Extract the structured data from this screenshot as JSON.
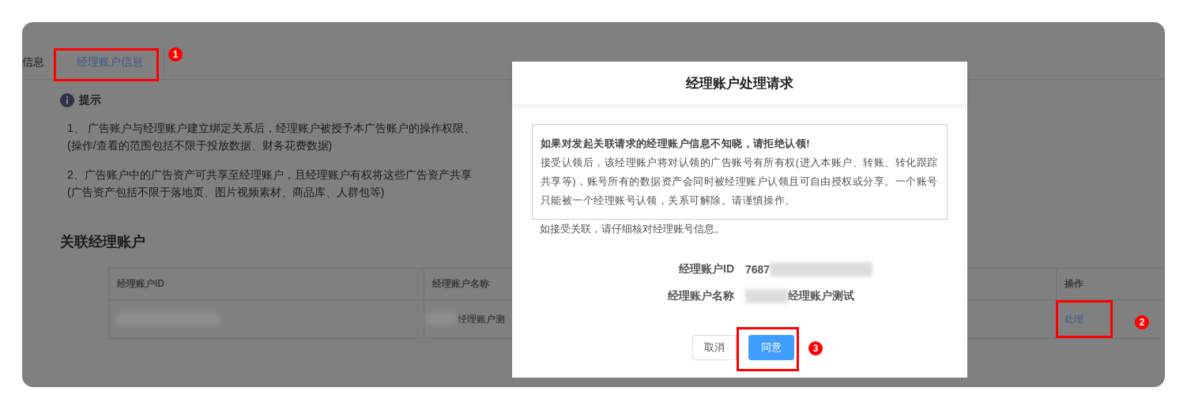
{
  "tabs": [
    {
      "label": "信息",
      "selected": false
    },
    {
      "label": "经理账户信息",
      "selected": true
    }
  ],
  "tip": {
    "title": "提示",
    "paragraphs": [
      [
        "1、 广告账户与经理账户建立绑定关系后，经理账户被授予本广告账户的操作权限、",
        "(操作/查看的范围包括不限于投放数据、财务花费数据)"
      ],
      [
        "2、广告账户中的广告资产可共享至经理账户，且经理账户有权将这些广告资产共享",
        "(广告资产包括不限于落地页、图片视频素材、商品库、人群包等)"
      ]
    ]
  },
  "section_title": "关联经理账户",
  "table": {
    "columns": [
      "经理账户ID",
      "经理账户名称",
      "操作"
    ],
    "rows": [
      {
        "cells": [
          {
            "kind": "redacted"
          },
          {
            "kind": "name",
            "text": "经理账户测"
          },
          {
            "kind": "action",
            "text": "处理"
          }
        ]
      }
    ]
  },
  "dialog": {
    "title": "经理账户处理请求",
    "notice": {
      "heading": "如果对发起关联请求的经理账户信息不知晓，请拒绝认领!",
      "body": "接受认领后，该经理账户将对认领的广告账号有所有权(进入本账户、转账、转化跟踪共享等)，账号所有的数据资产会同时被经理账户认领且可自由授权或分享。一个账号只能被一个经理账号认领，关系可解除。请谨慎操作。"
    },
    "hint": "如接受关联，请仔细核对经理账号信息。",
    "fields": [
      {
        "label": "经理账户ID",
        "value": "7687",
        "kind": "id"
      },
      {
        "label": "经理账户名称",
        "value": "经理账户测试",
        "kind": "name"
      }
    ],
    "buttons": [
      {
        "label": "取消",
        "kind": "default"
      },
      {
        "label": "同意",
        "kind": "primary"
      }
    ]
  },
  "annotations": [
    {
      "label": "1",
      "kind": "tab"
    },
    {
      "label": "2",
      "kind": "action"
    },
    {
      "label": "3",
      "kind": "confirm"
    }
  ]
}
